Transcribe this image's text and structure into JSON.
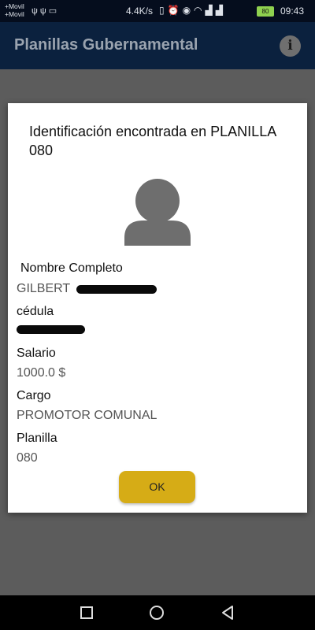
{
  "status_bar": {
    "carrier_1": "+Movil",
    "carrier_2": "+Movil",
    "net_speed": "4.4K/s",
    "battery": "80",
    "time": "09:43"
  },
  "app_bar": {
    "title": "Planillas Gubernamental",
    "info_icon": "info-icon"
  },
  "dialog": {
    "title": "Identificación encontrada en PLANILLA 080",
    "fields": [
      {
        "label": "Nombre Completo",
        "value": "GILBERT"
      },
      {
        "label": "cédula",
        "value": ""
      },
      {
        "label": "Salario",
        "value": "1000.0 $"
      },
      {
        "label": "Cargo",
        "value": "PROMOTOR COMUNAL"
      },
      {
        "label": "Planilla",
        "value": "080"
      }
    ],
    "ok_label": "OK"
  },
  "colors": {
    "app_bar": "#0b213e",
    "status_bar": "#050d1d",
    "ok_button": "#d6ac16",
    "dim_overlay": "#5c5c5c"
  }
}
